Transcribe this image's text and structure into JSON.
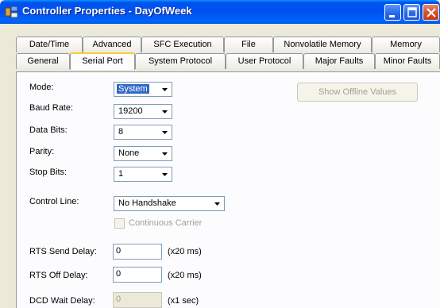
{
  "window": {
    "title": "Controller Properties - DayOfWeek",
    "minimize_icon": "minimize-icon",
    "maximize_icon": "maximize-icon",
    "close_icon": "close-icon",
    "app_icon": "controller-icon"
  },
  "tabs": {
    "row1": [
      {
        "label": "Date/Time"
      },
      {
        "label": "Advanced"
      },
      {
        "label": "SFC Execution"
      },
      {
        "label": "File"
      },
      {
        "label": "Nonvolatile Memory"
      },
      {
        "label": "Memory"
      }
    ],
    "row2": [
      {
        "label": "General"
      },
      {
        "label": "Serial Port",
        "active": true
      },
      {
        "label": "System Protocol"
      },
      {
        "label": "User Protocol"
      },
      {
        "label": "Major Faults"
      },
      {
        "label": "Minor Faults"
      }
    ]
  },
  "serial_port": {
    "mode": {
      "label": "Mode:",
      "value": "System"
    },
    "baud_rate": {
      "label": "Baud Rate:",
      "value": "19200"
    },
    "data_bits": {
      "label": "Data Bits:",
      "value": "8"
    },
    "parity": {
      "label": "Parity:",
      "value": "None"
    },
    "stop_bits": {
      "label": "Stop Bits:",
      "value": "1"
    },
    "control_line": {
      "label": "Control Line:",
      "value": "No Handshake"
    },
    "continuous_carrier": {
      "label": "Continuous Carrier",
      "checked": false,
      "enabled": false
    },
    "rts_send_delay": {
      "label": "RTS Send Delay:",
      "value": "0",
      "unit": "(x20 ms)"
    },
    "rts_off_delay": {
      "label": "RTS Off Delay:",
      "value": "0",
      "unit": "(x20 ms)"
    },
    "dcd_wait_delay": {
      "label": "DCD Wait Delay:",
      "value": "0",
      "unit": "(x1 sec)",
      "enabled": false
    },
    "show_offline_values": {
      "label": "Show Offline Values",
      "enabled": false
    }
  },
  "colors": {
    "titlebar": "#0054e3",
    "close_button": "#d4512a",
    "active_tab_accent": "#ffc83c",
    "selection": "#316ac5"
  }
}
